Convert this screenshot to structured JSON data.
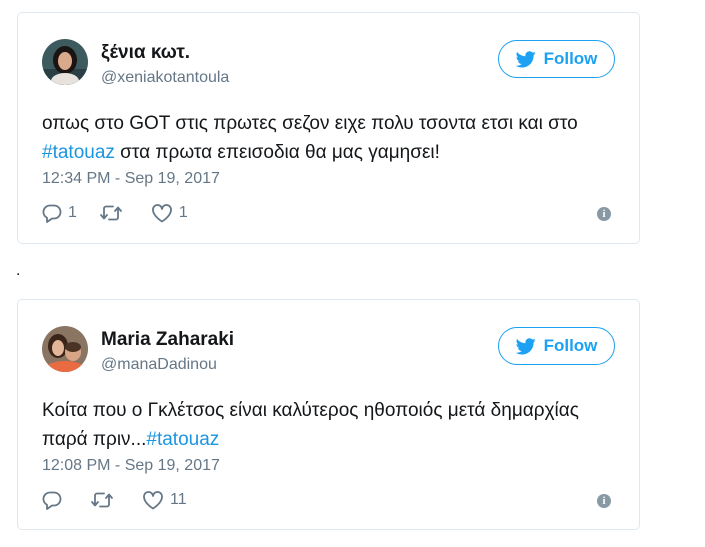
{
  "tweets": [
    {
      "name": "ξένια κωτ.",
      "handle": "@xeniakotantoula",
      "follow_label": "Follow",
      "text_before": "οπως στο GOT στις πρωτες σεζον ειχε πολυ τσοντα ετσι και στο ",
      "hashtag": "#tatouaz",
      "text_after": " στα πρωτα επεισοδια θα μας γαμησει!",
      "timestamp": "12:34 PM - Sep 19, 2017",
      "reply_count": "1",
      "retweet_count": "",
      "like_count": "1",
      "info_icon": "i"
    },
    {
      "name": "Maria Zaharaki",
      "handle": "@manaDadinou",
      "follow_label": "Follow",
      "text_before": "Κοίτα που ο Γκλέτσος είναι καλύτερος ηθοποιός μετά δημαρχίας παρά πριν...",
      "hashtag": "#tatouaz",
      "text_after": "",
      "timestamp": "12:08 PM - Sep 19, 2017",
      "reply_count": "",
      "retweet_count": "",
      "like_count": "11",
      "info_icon": "i"
    }
  ],
  "separator": ".",
  "colors": {
    "accent": "#1da1f2",
    "hashtag": "#1b95e0",
    "muted": "#657786",
    "border": "#e1e8ed"
  }
}
